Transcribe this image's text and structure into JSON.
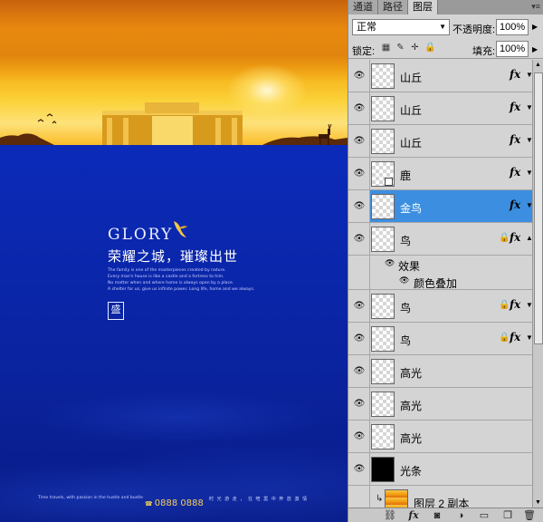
{
  "canvas": {
    "glory": "GLORY",
    "headline": "荣耀之城，璀璨出世",
    "body_lines": [
      "The family is one of the masterpieces created by nature.",
      "Every man's house is like a castle and a fortress to him.",
      "No matter when and where home is always open by a place.",
      "A shelter for us, give us infinite power. Long life, home and we always."
    ],
    "seal_char": "盛",
    "footer_left": "Time travels, with passion in the hustle and bustle",
    "footer_phone": "0888 0888",
    "footer_right": "时 光 游 走 ， 在 喧 嚣 中 奔 放 激 情",
    "colors": {
      "sky_top": "#c8630e",
      "sky_mid": "#f6a911",
      "sea": "#0a23b0",
      "gold": "#f5cf5a"
    }
  },
  "panel": {
    "tabs": [
      {
        "label": "通道",
        "active": false
      },
      {
        "label": "路径",
        "active": false
      },
      {
        "label": "图层",
        "active": true
      }
    ],
    "blend_mode": "正常",
    "opacity_label": "不透明度:",
    "opacity_value": "100%",
    "lock_label": "锁定:",
    "fill_label": "填充:",
    "fill_value": "100%",
    "fx_symbol": "fx",
    "layers": [
      {
        "name": "山丘",
        "fx": true
      },
      {
        "name": "山丘",
        "fx": true
      },
      {
        "name": "山丘",
        "fx": true
      },
      {
        "name": "鹿",
        "fx": true
      },
      {
        "name": "金鸟",
        "fx": true,
        "selected": true
      },
      {
        "name": "鸟",
        "fx": true,
        "locked": true
      },
      {
        "name": "效果"
      },
      {
        "name": "颜色叠加"
      },
      {
        "name": "鸟",
        "fx": true,
        "locked": true
      },
      {
        "name": "鸟",
        "fx": true,
        "locked": true
      },
      {
        "name": "高光"
      },
      {
        "name": "高光"
      },
      {
        "name": "高光"
      },
      {
        "name": "光条"
      },
      {
        "name": "图层 2 副本"
      }
    ],
    "bottom_icons": [
      "link-icon",
      "fx-icon",
      "mask-icon",
      "adjustment-icon",
      "folder-icon",
      "new-layer-icon",
      "trash-icon"
    ],
    "accent": "#3c8fe0"
  }
}
